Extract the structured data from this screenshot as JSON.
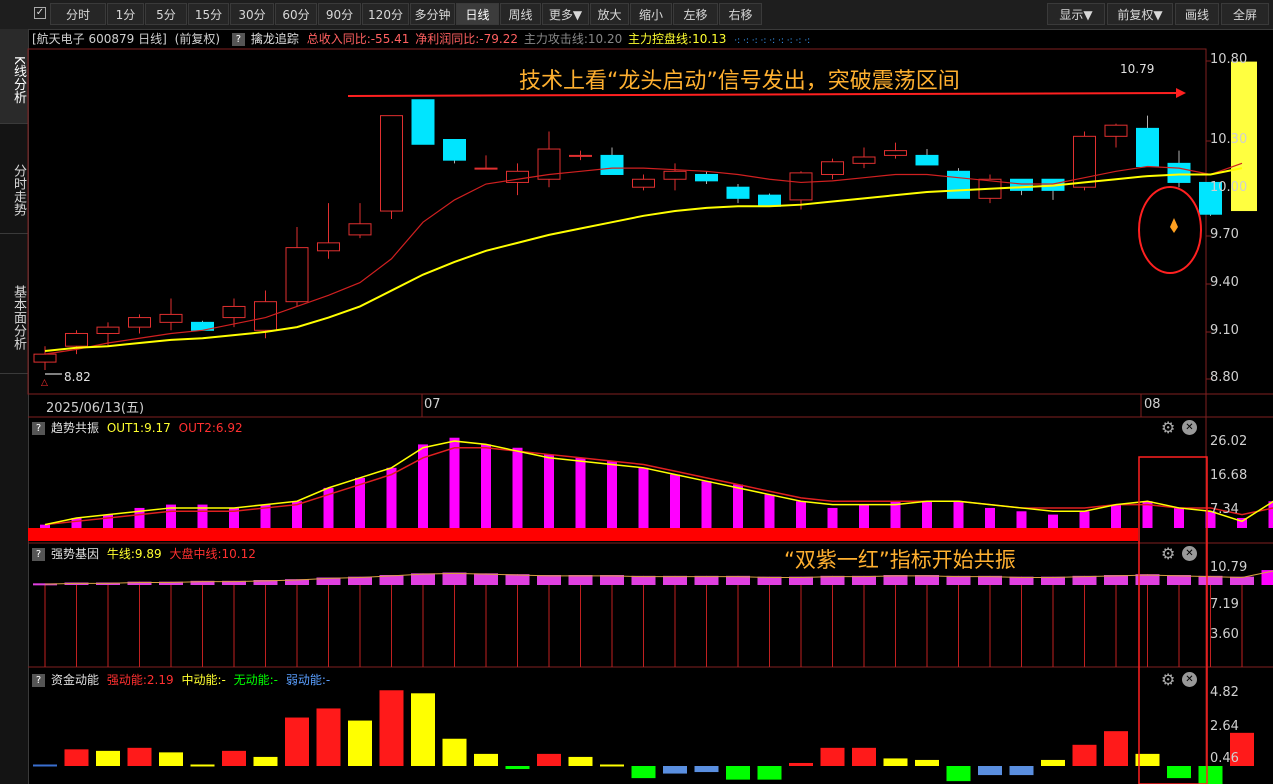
{
  "toolbar": {
    "checkbox": "✓",
    "buttons": [
      "分时",
      "1分",
      "5分",
      "15分",
      "30分",
      "60分",
      "90分",
      "120分",
      "多分钟",
      "日线",
      "周线",
      "更多▼",
      "放大",
      "缩小",
      "左移",
      "右移"
    ],
    "active": "日线",
    "right_buttons": [
      "显示▼",
      "前复权▼",
      "画线",
      "全屏"
    ]
  },
  "sidebar": {
    "tabs": [
      "K线分析",
      "分时走势",
      "基本面分析"
    ]
  },
  "infobar": {
    "stock": "[航天电子 600879 日线]",
    "adjust": "(前复权)",
    "indicator": "擒龙追踪",
    "revenue": "总收入同比:-55.41",
    "profit": "净利润同比:-79.22",
    "attack": "主力攻击线:10.20",
    "control": "主力控盘线:10.13",
    "marks": "·: ·: ·: ·: ·: ·: ·: ·: ·:"
  },
  "annotations": {
    "main": "技术上看“龙头启动”信号发出，突破震荡区间",
    "sub": "“双紫一红”指标开始共振"
  },
  "main_axis": {
    "ticks": [
      "10.80",
      "10.30",
      "10.00",
      "9.70",
      "9.40",
      "9.10",
      "8.80"
    ]
  },
  "price_labels": {
    "high": "10.79",
    "low": "8.82",
    "low_marker": "△"
  },
  "date_axis": {
    "first": "2025/06/13(五)",
    "m1": "07",
    "m2": "08"
  },
  "pane1": {
    "name": "趋势共振",
    "out1": "OUT1:9.17",
    "out2": "OUT2:6.92",
    "ticks": [
      "26.02",
      "16.68",
      "7.34"
    ]
  },
  "pane2": {
    "name": "强势基因",
    "bull": "牛线:9.89",
    "mid": "大盘中线:10.12",
    "ticks": [
      "10.79",
      "7.19",
      "3.60"
    ]
  },
  "pane3": {
    "name": "资金动能",
    "strong": "强动能:2.19",
    "middle": "中动能:-",
    "none": "无动能:-",
    "weak": "弱动能:-",
    "ticks": [
      "4.82",
      "2.64",
      "0.46"
    ]
  },
  "icons": {
    "question": "?",
    "gear": "⚙",
    "close": "✕"
  },
  "colors": {
    "up": "#ff3b3b",
    "down": "#00e0ff",
    "yellow": "#ffff00",
    "magenta": "#ff00ff",
    "annot": "#ffb030",
    "highlight": "#ffff40"
  },
  "chart_data": [
    {
      "type": "candlestick",
      "title": "航天电子 600879 日线",
      "ylim": [
        8.8,
        10.8
      ],
      "series": [
        {
          "name": "price",
          "ohlc": [
            [
              8.9,
              9.0,
              8.85,
              8.95
            ],
            [
              9.0,
              9.1,
              8.95,
              9.08
            ],
            [
              9.08,
              9.15,
              9.0,
              9.12
            ],
            [
              9.12,
              9.2,
              9.08,
              9.18
            ],
            [
              9.15,
              9.3,
              9.1,
              9.2
            ],
            [
              9.15,
              9.16,
              9.1,
              9.1
            ],
            [
              9.18,
              9.3,
              9.12,
              9.25
            ],
            [
              9.1,
              9.35,
              9.05,
              9.28
            ],
            [
              9.28,
              9.75,
              9.25,
              9.62
            ],
            [
              9.6,
              9.9,
              9.55,
              9.65
            ],
            [
              9.7,
              9.9,
              9.68,
              9.77
            ],
            [
              9.85,
              10.45,
              9.8,
              10.45
            ],
            [
              10.55,
              10.55,
              10.3,
              10.27
            ],
            [
              10.3,
              10.3,
              10.15,
              10.17
            ],
            [
              10.12,
              10.2,
              10.12,
              10.12
            ],
            [
              10.03,
              10.15,
              9.95,
              10.1
            ],
            [
              10.05,
              10.35,
              10.0,
              10.24
            ],
            [
              10.2,
              10.23,
              10.17,
              10.2
            ],
            [
              10.2,
              10.25,
              10.08,
              10.08
            ],
            [
              10.0,
              10.08,
              9.98,
              10.05
            ],
            [
              10.05,
              10.15,
              9.98,
              10.1
            ],
            [
              10.08,
              10.1,
              10.02,
              10.04
            ],
            [
              10.0,
              10.02,
              9.9,
              9.93
            ],
            [
              9.95,
              9.96,
              9.88,
              9.88
            ],
            [
              9.92,
              10.1,
              9.86,
              10.09
            ],
            [
              10.08,
              10.18,
              10.05,
              10.16
            ],
            [
              10.15,
              10.25,
              10.12,
              10.19
            ],
            [
              10.2,
              10.28,
              10.18,
              10.23
            ],
            [
              10.2,
              10.24,
              10.14,
              10.14
            ],
            [
              10.1,
              10.12,
              9.93,
              9.93
            ],
            [
              9.93,
              10.08,
              9.9,
              10.05
            ],
            [
              10.05,
              10.05,
              9.95,
              9.98
            ],
            [
              10.05,
              10.05,
              9.92,
              9.98
            ],
            [
              10.0,
              10.35,
              9.98,
              10.32
            ],
            [
              10.32,
              10.4,
              10.25,
              10.39
            ],
            [
              10.37,
              10.45,
              10.13,
              10.13
            ],
            [
              10.15,
              10.23,
              10.0,
              10.03
            ],
            [
              10.03,
              10.03,
              9.82,
              9.83
            ],
            [
              9.85,
              10.79,
              9.85,
              10.79
            ]
          ]
        },
        {
          "name": "MA-fast",
          "values": [
            8.95,
            8.98,
            9.02,
            9.05,
            9.08,
            9.1,
            9.14,
            9.18,
            9.25,
            9.32,
            9.4,
            9.55,
            9.78,
            9.92,
            10.02,
            10.05,
            10.08,
            10.1,
            10.12,
            10.12,
            10.11,
            10.1,
            10.08,
            10.05,
            10.03,
            10.04,
            10.06,
            10.08,
            10.08,
            10.06,
            10.04,
            10.02,
            10.02,
            10.06,
            10.1,
            10.13,
            10.12,
            10.08,
            10.15
          ]
        },
        {
          "name": "MA-slow",
          "values": [
            8.97,
            8.99,
            9.0,
            9.02,
            9.04,
            9.05,
            9.07,
            9.09,
            9.12,
            9.18,
            9.25,
            9.35,
            9.45,
            9.53,
            9.6,
            9.65,
            9.7,
            9.74,
            9.78,
            9.82,
            9.85,
            9.87,
            9.88,
            9.88,
            9.89,
            9.91,
            9.93,
            9.95,
            9.97,
            9.98,
            9.99,
            10.0,
            10.01,
            10.03,
            10.05,
            10.07,
            10.08,
            10.08,
            10.12
          ]
        }
      ]
    },
    {
      "type": "bar",
      "title": "趋势共振",
      "ylim": [
        0,
        26.02
      ],
      "values": [
        1,
        3,
        4,
        6,
        7,
        7,
        6,
        7,
        8,
        12,
        15,
        18,
        25,
        27,
        25,
        24,
        22,
        21,
        20,
        18,
        16,
        14,
        13,
        10,
        8,
        6,
        7,
        8,
        8,
        8,
        6,
        5,
        4,
        5,
        7,
        8,
        6,
        5,
        3,
        8
      ],
      "series": [
        {
          "name": "OUT1",
          "values": [
            1,
            3,
            4,
            5,
            6,
            6,
            6,
            7,
            8,
            12,
            15,
            18,
            24,
            26,
            25,
            23,
            21,
            20,
            19,
            18,
            16,
            14,
            12,
            10,
            8,
            7,
            7,
            7,
            8,
            8,
            7,
            6,
            5,
            5,
            7,
            8,
            6,
            5,
            2,
            8
          ]
        },
        {
          "name": "OUT2",
          "values": [
            1,
            2,
            3,
            4,
            5,
            5,
            5,
            6,
            7,
            10,
            13,
            16,
            21,
            24,
            24,
            23,
            22,
            21,
            20,
            19,
            17,
            15,
            13,
            11,
            9,
            8,
            8,
            8,
            8,
            8,
            7,
            6,
            6,
            6,
            7,
            7,
            6,
            6,
            4,
            6
          ]
        }
      ]
    },
    {
      "type": "bar",
      "title": "强势基因",
      "ylim": [
        0,
        10.79
      ],
      "values": [
        9.2,
        9.3,
        9.3,
        9.4,
        9.4,
        9.5,
        9.5,
        9.6,
        9.7,
        9.9,
        10.0,
        10.2,
        10.4,
        10.5,
        10.4,
        10.3,
        10.2,
        10.2,
        10.2,
        10.1,
        10.1,
        10.1,
        10.1,
        10.0,
        10.0,
        10.1,
        10.1,
        10.2,
        10.2,
        10.1,
        10.1,
        10.0,
        10.0,
        10.1,
        10.2,
        10.3,
        10.2,
        10.1,
        10.0,
        10.79
      ]
    },
    {
      "type": "bar",
      "title": "资金动能",
      "ylim": [
        -0.6,
        5.2
      ],
      "values": [
        0.1,
        1.1,
        1.0,
        1.2,
        0.9,
        0.1,
        1.0,
        0.6,
        3.2,
        3.8,
        3.0,
        5.0,
        4.8,
        1.8,
        0.8,
        -0.2,
        0.8,
        0.6,
        0.1,
        -0.8,
        -0.5,
        -0.4,
        -0.9,
        -0.9,
        0.2,
        1.2,
        1.2,
        0.5,
        0.4,
        -1.0,
        -0.6,
        -0.6,
        0.4,
        1.4,
        2.3,
        0.8,
        -0.8,
        -1.6,
        2.19
      ],
      "colors": [
        "#3a6fd0",
        "#ff1a1a",
        "#ffff00",
        "#ff1a1a",
        "#ffff00",
        "#ffff00",
        "#ff1a1a",
        "#ffff00",
        "#ff1a1a",
        "#ff1a1a",
        "#ffff00",
        "#ff1a1a",
        "#ffff00",
        "#ffff00",
        "#ffff00",
        "#00ff00",
        "#ff1a1a",
        "#ffff00",
        "#ffff00",
        "#00ff00",
        "#5a8fe0",
        "#5a8fe0",
        "#00ff00",
        "#00ff00",
        "#ff1a1a",
        "#ff1a1a",
        "#ff1a1a",
        "#ffff00",
        "#ffff00",
        "#00ff00",
        "#5a8fe0",
        "#5a8fe0",
        "#ffff00",
        "#ff1a1a",
        "#ff1a1a",
        "#ffff00",
        "#00ff00",
        "#00ff00",
        "#ff1a1a"
      ]
    }
  ]
}
